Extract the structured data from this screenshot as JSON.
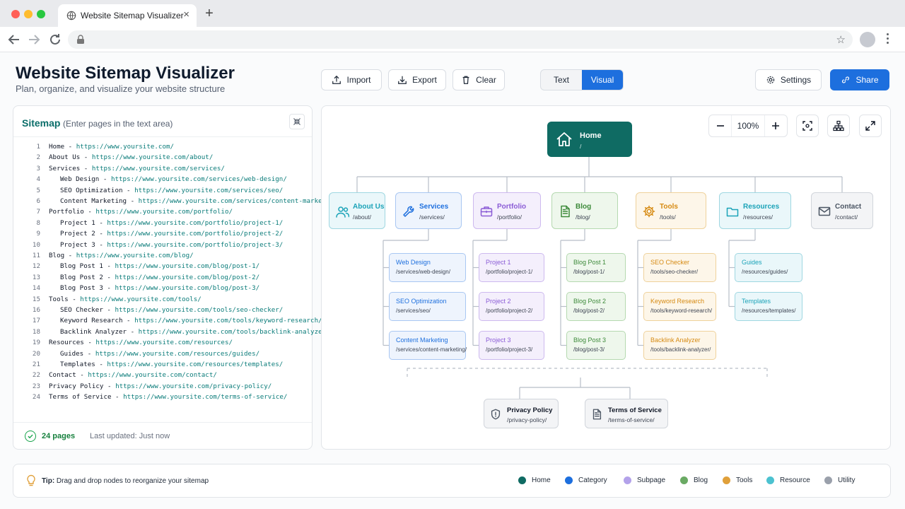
{
  "browser": {
    "tab_title": "Website Sitemap Visualizer"
  },
  "header": {
    "title": "Website Sitemap Visualizer",
    "subtitle": "Plan, organize, and visualize your website structure",
    "import_label": "Import",
    "export_label": "Export",
    "clear_label": "Clear",
    "mode_text": "Text",
    "mode_visual": "Visual",
    "settings_label": "Settings",
    "share_label": "Share"
  },
  "sitemap_panel": {
    "title": "Sitemap",
    "hint": "(Enter pages in the text area)",
    "lines": [
      {
        "n": "1",
        "indent": 0,
        "name": "Home",
        "url": "https://www.yoursite.com/"
      },
      {
        "n": "2",
        "indent": 0,
        "name": "About Us",
        "url": "https://www.yoursite.com/about/"
      },
      {
        "n": "3",
        "indent": 0,
        "name": "Services",
        "url": "https://www.yoursite.com/services/"
      },
      {
        "n": "4",
        "indent": 1,
        "name": "Web Design",
        "url": "https://www.yoursite.com/services/web-design/"
      },
      {
        "n": "5",
        "indent": 1,
        "name": "SEO Optimization",
        "url": "https://www.yoursite.com/services/seo/"
      },
      {
        "n": "6",
        "indent": 1,
        "name": "Content Marketing",
        "url": "https://www.yoursite.com/services/content-marketing/"
      },
      {
        "n": "7",
        "indent": 0,
        "name": "Portfolio",
        "url": "https://www.yoursite.com/portfolio/"
      },
      {
        "n": "8",
        "indent": 1,
        "name": "Project 1",
        "url": "https://www.yoursite.com/portfolio/project-1/"
      },
      {
        "n": "9",
        "indent": 1,
        "name": "Project 2",
        "url": "https://www.yoursite.com/portfolio/project-2/"
      },
      {
        "n": "10",
        "indent": 1,
        "name": "Project 3",
        "url": "https://www.yoursite.com/portfolio/project-3/"
      },
      {
        "n": "11",
        "indent": 0,
        "name": "Blog",
        "url": "https://www.yoursite.com/blog/"
      },
      {
        "n": "12",
        "indent": 1,
        "name": "Blog Post 1",
        "url": "https://www.yoursite.com/blog/post-1/"
      },
      {
        "n": "13",
        "indent": 1,
        "name": "Blog Post 2",
        "url": "https://www.yoursite.com/blog/post-2/"
      },
      {
        "n": "14",
        "indent": 1,
        "name": "Blog Post 3",
        "url": "https://www.yoursite.com/blog/post-3/"
      },
      {
        "n": "15",
        "indent": 0,
        "name": "Tools",
        "url": "https://www.yoursite.com/tools/"
      },
      {
        "n": "16",
        "indent": 1,
        "name": "SEO Checker",
        "url": "https://www.yoursite.com/tools/seo-checker/"
      },
      {
        "n": "17",
        "indent": 1,
        "name": "Keyword Research",
        "url": "https://www.yoursite.com/tools/keyword-research/"
      },
      {
        "n": "18",
        "indent": 1,
        "name": "Backlink Analyzer",
        "url": "https://www.yoursite.com/tools/backlink-analyzer/"
      },
      {
        "n": "19",
        "indent": 0,
        "name": "Resources",
        "url": "https://www.yoursite.com/resources/"
      },
      {
        "n": "20",
        "indent": 1,
        "name": "Guides",
        "url": "https://www.yoursite.com/resources/guides/"
      },
      {
        "n": "21",
        "indent": 1,
        "name": "Templates",
        "url": "https://www.yoursite.com/resources/templates/"
      },
      {
        "n": "22",
        "indent": 0,
        "name": "Contact",
        "url": "https://www.yoursite.com/contact/"
      },
      {
        "n": "23",
        "indent": 0,
        "name": "Privacy Policy",
        "url": "https://www.yoursite.com/privacy-policy/"
      },
      {
        "n": "24",
        "indent": 0,
        "name": "Terms of Service",
        "url": "https://www.yoursite.com/terms-of-service/"
      }
    ],
    "separator": " - ",
    "page_count": "24 pages",
    "last_updated": "Last updated: Just now"
  },
  "canvas": {
    "zoom_level": "100%",
    "root": {
      "title": "Home",
      "path": "/"
    },
    "categories": [
      {
        "title": "About Us",
        "path": "/about/",
        "icon": "users-icon",
        "color": "#1ba3b8",
        "bg": "#eaf7fa",
        "border": "#9fd7e1"
      },
      {
        "title": "Services",
        "path": "/services/",
        "icon": "wrench-icon",
        "color": "#1d6fde",
        "bg": "#eef4fd",
        "border": "#a9c7f2"
      },
      {
        "title": "Portfolio",
        "path": "/portfolio/",
        "icon": "briefcase-icon",
        "color": "#8b5cd6",
        "bg": "#f4effc",
        "border": "#cdb9ef"
      },
      {
        "title": "Blog",
        "path": "/blog/",
        "icon": "document-icon",
        "color": "#3d8a3a",
        "bg": "#eef7ec",
        "border": "#b5d9b0"
      },
      {
        "title": "Tools",
        "path": "/tools/",
        "icon": "gear-icon",
        "color": "#d68a12",
        "bg": "#fdf6e9",
        "border": "#efd29c"
      },
      {
        "title": "Resources",
        "path": "/resources/",
        "icon": "folder-icon",
        "color": "#1ba3b8",
        "bg": "#eaf7fa",
        "border": "#9fd7e1"
      },
      {
        "title": "Contact",
        "path": "/contact/",
        "icon": "mail-icon",
        "color": "#4b5563",
        "bg": "#f3f4f6",
        "border": "#d1d5db"
      }
    ],
    "children": [
      [],
      [
        {
          "title": "Web Design",
          "path": "/services/web-design/"
        },
        {
          "title": "SEO Optimization",
          "path": "/services/seo/"
        },
        {
          "title": "Content Marketing",
          "path": "/services/content-marketing/"
        }
      ],
      [
        {
          "title": "Project 1",
          "path": "/portfolio/project-1/"
        },
        {
          "title": "Project 2",
          "path": "/portfolio/project-2/"
        },
        {
          "title": "Project 3",
          "path": "/portfolio/project-3/"
        }
      ],
      [
        {
          "title": "Blog Post 1",
          "path": "/blog/post-1/"
        },
        {
          "title": "Blog Post 2",
          "path": "/blog/post-2/"
        },
        {
          "title": "Blog Post 3",
          "path": "/blog/post-3/"
        }
      ],
      [
        {
          "title": "SEO Checker",
          "path": "/tools/seo-checker/"
        },
        {
          "title": "Keyword Research",
          "path": "/tools/keyword-research/"
        },
        {
          "title": "Backlink Analyzer",
          "path": "/tools/backlink-analyzer/"
        }
      ],
      [
        {
          "title": "Guides",
          "path": "/resources/guides/"
        },
        {
          "title": "Templates",
          "path": "/resources/templates/"
        }
      ],
      []
    ],
    "utility": [
      {
        "title": "Privacy Policy",
        "path": "/privacy-policy/",
        "icon": "shield-icon"
      },
      {
        "title": "Terms of Service",
        "path": "/terms-of-service/",
        "icon": "document-icon"
      }
    ]
  },
  "footer": {
    "tip_bold": "Tip:",
    "tip_text": " Drag and drop nodes to reorganize your sitemap",
    "legend": [
      {
        "label": "Home",
        "color": "#0f6b63"
      },
      {
        "label": "Category",
        "color": "#1d6fde"
      },
      {
        "label": "Subpage",
        "color": "#b3a2ea"
      },
      {
        "label": "Blog",
        "color": "#6aaa64"
      },
      {
        "label": "Tools",
        "color": "#e0a03a"
      },
      {
        "label": "Resource",
        "color": "#4cc2d0"
      },
      {
        "label": "Utility",
        "color": "#9aa0ab"
      }
    ]
  }
}
